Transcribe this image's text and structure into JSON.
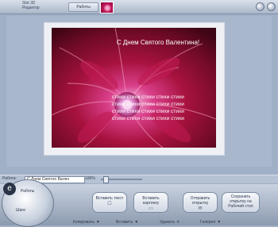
{
  "app": {
    "label_line1": "Slot 3D",
    "label_line2": "Редактор",
    "tab_label": "Работы"
  },
  "card": {
    "title": "С Днем Святого Валентина!",
    "poem": [
      "стихи стихи стихи стихи стихи",
      "стихи стихи стихи стихи стихи",
      "стихи стихи стихи стихи стихи",
      "стихи стихи стихи стихи стихи"
    ]
  },
  "status": {
    "label": "Работа:",
    "name_value": "С Днем Святого Вален",
    "zoom": "100%"
  },
  "dial": {
    "label_top": "Работы",
    "label_bottom": "Шаги"
  },
  "actions": [
    {
      "label": "Вставить текст",
      "icon": "text-icon"
    },
    {
      "label": "Вставить картинку",
      "icon": "image-icon"
    },
    {
      "label": "Отправить открытку",
      "icon": "envelope-icon"
    },
    {
      "label": "Сохранить открытку на Рабочий стол",
      "icon": "save-icon"
    }
  ],
  "menus": [
    {
      "label": "Копировать"
    },
    {
      "label": "Вставить"
    },
    {
      "label": "Удалить"
    },
    {
      "label": "Галерея"
    }
  ]
}
